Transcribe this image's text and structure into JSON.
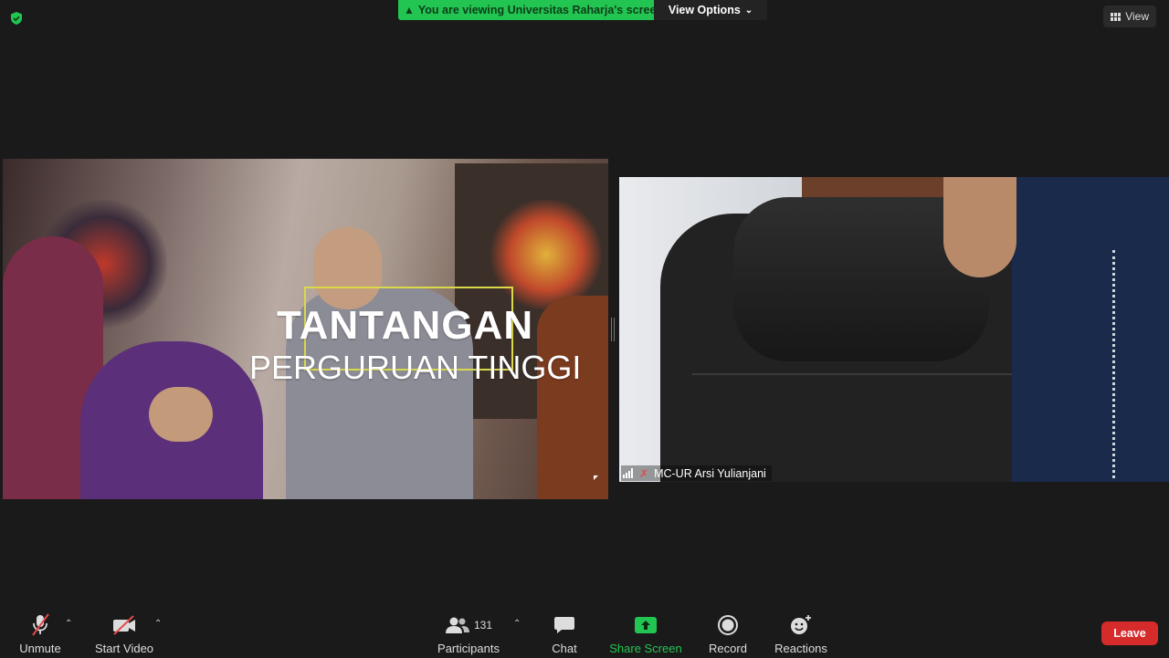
{
  "top": {
    "banner_text": "You are viewing Universitas Raharja's screen",
    "view_options_label": "View Options",
    "view_label": "View"
  },
  "shared_screen": {
    "title_line1": "TANTANGAN",
    "title_line2": "PERGURUAN TINGGI"
  },
  "participant": {
    "name": "MC-UR Arsi Yulianjani"
  },
  "toolbar": {
    "unmute_label": "Unmute",
    "start_video_label": "Start Video",
    "participants_label": "Participants",
    "participants_count": "131",
    "chat_label": "Chat",
    "share_screen_label": "Share Screen",
    "record_label": "Record",
    "reactions_label": "Reactions",
    "leave_label": "Leave"
  },
  "colors": {
    "banner_green": "#23c552",
    "leave_red": "#d52b2b",
    "share_green": "#23c552",
    "muted_red": "#e54848"
  }
}
